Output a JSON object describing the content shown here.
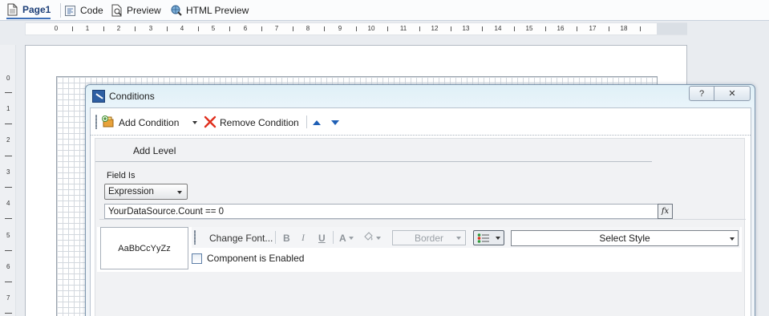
{
  "tabs": [
    {
      "label": "Page1",
      "icon": "page-icon"
    },
    {
      "label": "Code",
      "icon": "code-icon"
    },
    {
      "label": "Preview",
      "icon": "preview-icon"
    },
    {
      "label": "HTML Preview",
      "icon": "html-preview-icon"
    }
  ],
  "ruler": {
    "top": [
      "0",
      "1",
      "2",
      "3",
      "4",
      "5",
      "6",
      "7",
      "8",
      "9",
      "10",
      "11",
      "12",
      "13",
      "14",
      "15",
      "16",
      "17",
      "18"
    ],
    "left": [
      "0",
      "1",
      "2",
      "3",
      "4",
      "5",
      "6",
      "7"
    ]
  },
  "dialog": {
    "title": "Conditions",
    "help_label": "?",
    "close_label": "✕",
    "toolbar": {
      "add_label": "Add Condition",
      "remove_label": "Remove Condition"
    },
    "add_level_label": "Add Level",
    "field_is_label": "Field Is",
    "field_type_value": "Expression",
    "expression_value": "YourDataSource.Count == 0",
    "fx_label": "fx",
    "preview_text": "AaBbCcYyZz",
    "change_font_label": "Change Font...",
    "bold_label": "B",
    "italic_label": "I",
    "underline_label": "U",
    "font_color_label": "A",
    "border_label": "Border",
    "select_style_label": "Select Style",
    "component_enabled_label": "Component is Enabled",
    "component_enabled_checked": false
  },
  "colors": {
    "accent": "#1f5fb5",
    "active_tab": "#1d3f78",
    "remove_icon": "#e0301e"
  }
}
